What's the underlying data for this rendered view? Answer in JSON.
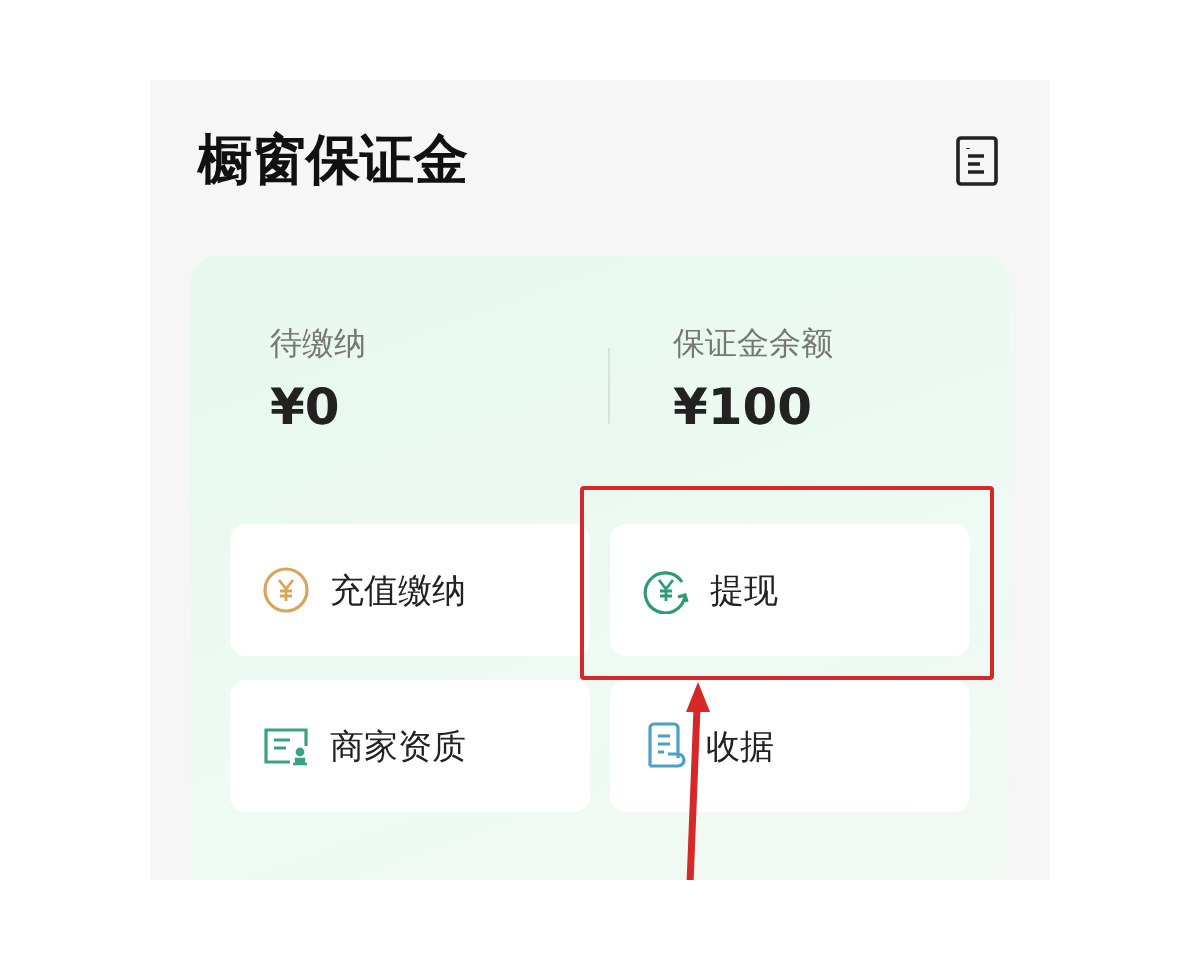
{
  "title": "橱窗保证金",
  "stats": [
    {
      "label": "待缴纳",
      "value": "¥0"
    },
    {
      "label": "保证金余额",
      "value": "¥100"
    }
  ],
  "actions": [
    {
      "label": "充值缴纳",
      "kind": "coin",
      "highlighted": false
    },
    {
      "label": "提现",
      "kind": "withdraw",
      "highlighted": true
    },
    {
      "label": "商家资质",
      "kind": "license",
      "highlighted": false
    },
    {
      "label": "收据",
      "kind": "receipt",
      "highlighted": false
    }
  ]
}
